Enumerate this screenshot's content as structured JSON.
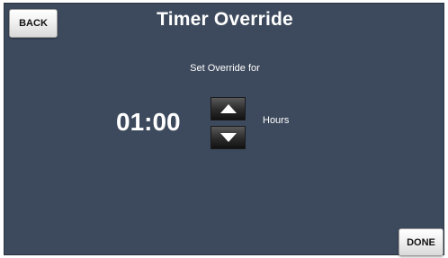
{
  "header": {
    "title": "Timer Override",
    "back_label": "BACK"
  },
  "override": {
    "prompt": "Set Override for",
    "value": "01:00",
    "unit": "Hours",
    "increase_icon": "triangle-up-icon",
    "decrease_icon": "triangle-down-icon"
  },
  "footer": {
    "done_label": "DONE"
  },
  "colors": {
    "background": "#3d4a5d",
    "text": "#ffffff",
    "button_light": "#f1f1f1",
    "button_dark": "#2e2e2e"
  }
}
